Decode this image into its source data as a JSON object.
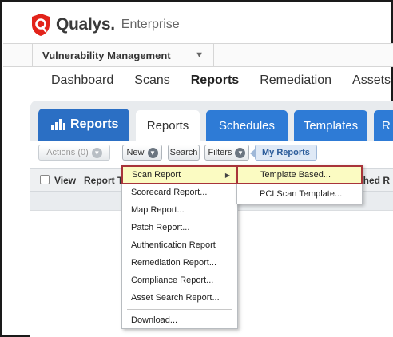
{
  "brand": {
    "name": "Qualys.",
    "edition": "Enterprise",
    "logo_icon": "qualys-shield-icon",
    "logo_color": "#e2231a"
  },
  "module": {
    "selected": "Vulnerability Management",
    "chevron_icon": "chevron-down-icon"
  },
  "topnav": {
    "items": [
      "Dashboard",
      "Scans",
      "Reports",
      "Remediation",
      "Assets"
    ],
    "active": "Reports"
  },
  "panel": {
    "badge_label": "Reports",
    "badge_icon": "bar-chart-icon",
    "tabs": [
      "Reports",
      "Schedules",
      "Templates",
      "R"
    ],
    "active_tab": "Reports",
    "accent_color": "#2e7bd6"
  },
  "toolbar": {
    "actions_label": "Actions (0)",
    "new_label": "New",
    "search_label": "Search",
    "filters_label": "Filters",
    "my_reports_label": "My Reports"
  },
  "grid": {
    "columns": [
      "View",
      "Report T"
    ],
    "right_partial": "ched  R"
  },
  "new_menu": {
    "items": [
      "Scan Report",
      "Scorecard Report...",
      "Map Report...",
      "Patch Report...",
      "Authentication Report",
      "Remediation Report...",
      "Compliance Report...",
      "Asset Search Report...",
      "Download..."
    ],
    "highlighted": "Scan Report",
    "submenu_arrow_icon": "triangle-right-icon"
  },
  "scan_submenu": {
    "items": [
      "Template Based...",
      "PCI Scan Template..."
    ],
    "highlighted": "Template Based..."
  }
}
